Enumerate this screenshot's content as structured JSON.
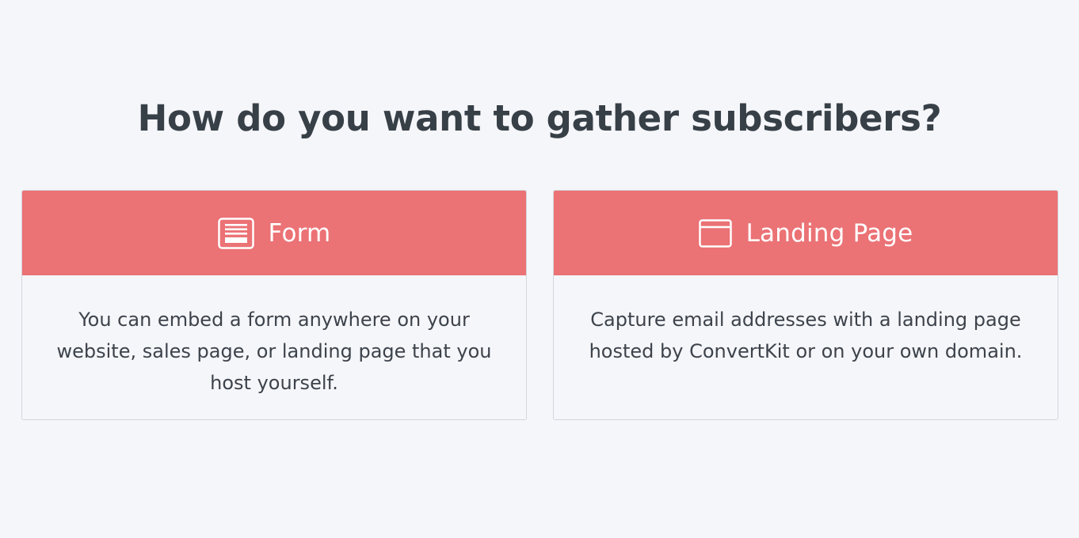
{
  "page": {
    "title": "How do you want to gather subscribers?"
  },
  "options": [
    {
      "label": "Form",
      "icon": "form-icon",
      "description": "You can embed a form anywhere on your website, sales page, or landing page that you host yourself."
    },
    {
      "label": "Landing Page",
      "icon": "browser-window-icon",
      "description": "Capture email addresses with a landing page hosted by ConvertKit or on your own domain."
    }
  ],
  "colors": {
    "background": "#f5f6fa",
    "header_accent": "#eb7275",
    "title_text": "#373f47",
    "body_text": "#3d434b",
    "card_border": "#d3d6dc"
  }
}
